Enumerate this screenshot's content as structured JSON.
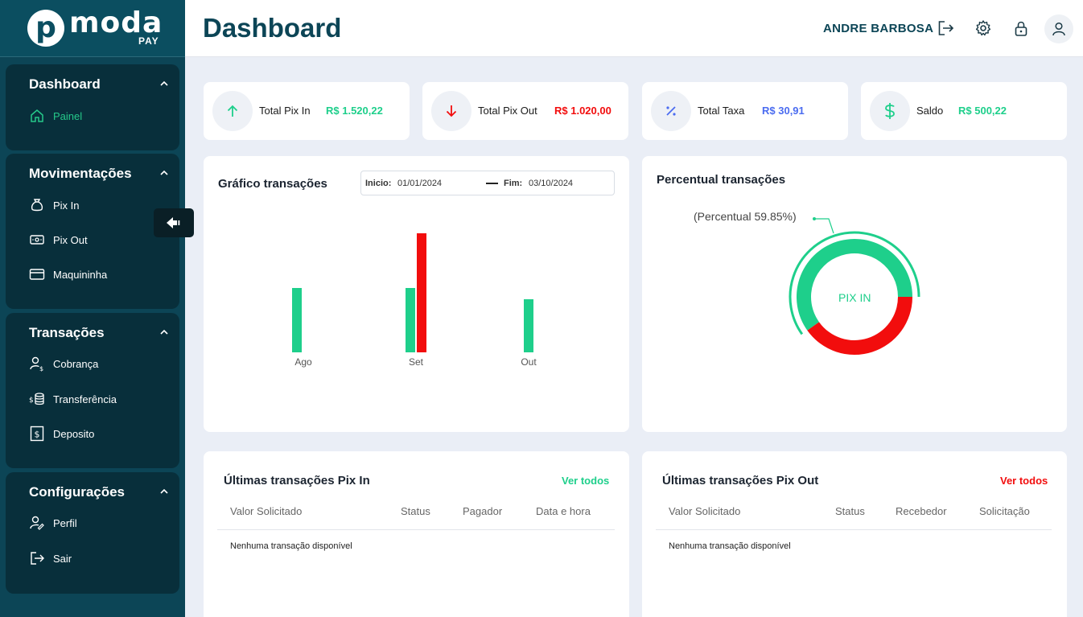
{
  "brand": {
    "initial": "p",
    "name": "moda",
    "sub": "PAY"
  },
  "sidebar": {
    "groups": [
      {
        "title": "Dashboard",
        "items": [
          {
            "label": "Painel",
            "icon": "home-icon",
            "active": true
          }
        ]
      },
      {
        "title": "Movimentações",
        "items": [
          {
            "label": "Pix In",
            "icon": "money-bag-icon"
          },
          {
            "label": "Pix Out",
            "icon": "banknote-icon"
          },
          {
            "label": "Maquininha",
            "icon": "credit-card-icon"
          }
        ]
      },
      {
        "title": "Transações",
        "items": [
          {
            "label": "Cobrança",
            "icon": "user-dollar-icon"
          },
          {
            "label": "Transferência",
            "icon": "coins-stack-icon"
          },
          {
            "label": "Deposito",
            "icon": "receipt-dollar-icon"
          }
        ]
      },
      {
        "title": "Configurações",
        "items": [
          {
            "label": "Perfil",
            "icon": "user-edit-icon"
          },
          {
            "label": "Sair",
            "icon": "logout-icon"
          }
        ]
      }
    ]
  },
  "header": {
    "title": "Dashboard",
    "user_name": "ANDRE BARBOSA",
    "icons": [
      "logout-icon",
      "gear-icon",
      "lock-icon",
      "user-icon"
    ]
  },
  "stats": [
    {
      "label": "Total Pix In",
      "value": "R$ 1.520,22",
      "color": "#1ecf8b",
      "icon": "arrow-up-icon"
    },
    {
      "label": "Total Pix Out",
      "value": "R$ 1.020,00",
      "color": "#f20d0d",
      "icon": "arrow-down-icon"
    },
    {
      "label": "Total Taxa",
      "value": "R$ 30,91",
      "color": "#4b6cf0",
      "icon": "percent-icon"
    },
    {
      "label": "Saldo",
      "value": "R$ 500,22",
      "color": "#1ecf8b",
      "icon": "dollar-icon"
    }
  ],
  "transactions_chart": {
    "title": "Gráfico transações",
    "start_label": "Inicio:",
    "start_date": "01/01/2024",
    "end_label": "Fim:",
    "end_date": "03/10/2024"
  },
  "chart_data": [
    {
      "type": "bar",
      "title": "Gráfico transações",
      "categories": [
        "Ago",
        "Set",
        "Out"
      ],
      "series": [
        {
          "color": "#1ecf8b",
          "values": [
            80,
            80,
            66
          ]
        },
        {
          "color": "#f20d0d",
          "values": [
            0,
            148,
            0
          ]
        }
      ],
      "grid": false
    },
    {
      "type": "pie",
      "title": "Percentual transações",
      "center_label": "PIX IN",
      "annotation": "(Percentual 59.85%)",
      "slices": [
        {
          "label": "PIX IN",
          "value": 59.85,
          "color": "#1ecf8b"
        },
        {
          "value": 40.15,
          "color": "#f20d0d"
        }
      ]
    }
  ],
  "percent_panel": {
    "title": "Percentual transações",
    "annotation": "(Percentual 59.85%)",
    "center_label": "PIX IN"
  },
  "pix_in_table": {
    "title": "Últimas transações Pix In",
    "view_all": "Ver todos",
    "view_all_color": "#1ecf8b",
    "columns": [
      "Valor Solicitado",
      "Status",
      "Pagador",
      "Data e hora"
    ],
    "empty": "Nenhuma transação disponível"
  },
  "pix_out_table": {
    "title": "Últimas transações Pix Out",
    "view_all": "Ver todos",
    "view_all_color": "#f20d0d",
    "columns": [
      "Valor Solicitado",
      "Status",
      "Recebedor",
      "Solicitação"
    ],
    "empty": "Nenhuma transação disponível"
  }
}
